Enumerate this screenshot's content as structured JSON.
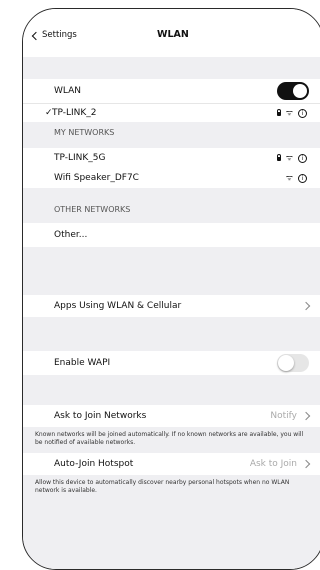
{
  "header": {
    "back_label": "Settings",
    "title": "WLAN"
  },
  "wlan": {
    "label": "WLAN",
    "enabled": true
  },
  "connected": {
    "name": "TP-LINK_2",
    "icons": [
      "lock-icon",
      "wifi-icon",
      "info-icon"
    ]
  },
  "my_networks": {
    "header": "MY NETWORKS",
    "items": [
      {
        "name": "TP-LINK_5G",
        "icons": [
          "lock-icon",
          "wifi-icon",
          "info-icon"
        ]
      },
      {
        "name": "Wifi Speaker_DF7C",
        "icons": [
          "wifi-icon",
          "info-icon"
        ]
      }
    ]
  },
  "other_networks": {
    "header": "OTHER NETWORKS",
    "other_label": "Other..."
  },
  "apps_row": {
    "label": "Apps Using WLAN & Cellular"
  },
  "wapi": {
    "label": "Enable WAPI",
    "enabled": false
  },
  "ask_join": {
    "label": "Ask to Join Networks",
    "value": "Notify",
    "note": "Known networks will be joined automatically. If no known networks are available, you will be notified of available networks."
  },
  "auto_join": {
    "label": "Auto-Join Hotspot",
    "value": "Ask to Join",
    "note": "Allow this device to automatically discover nearby personal hotspots when no WLAN network is available."
  },
  "colors": {
    "toggle_on": "#111111",
    "toggle_off": "#e6e6e6",
    "section_bg": "#efeff2"
  }
}
